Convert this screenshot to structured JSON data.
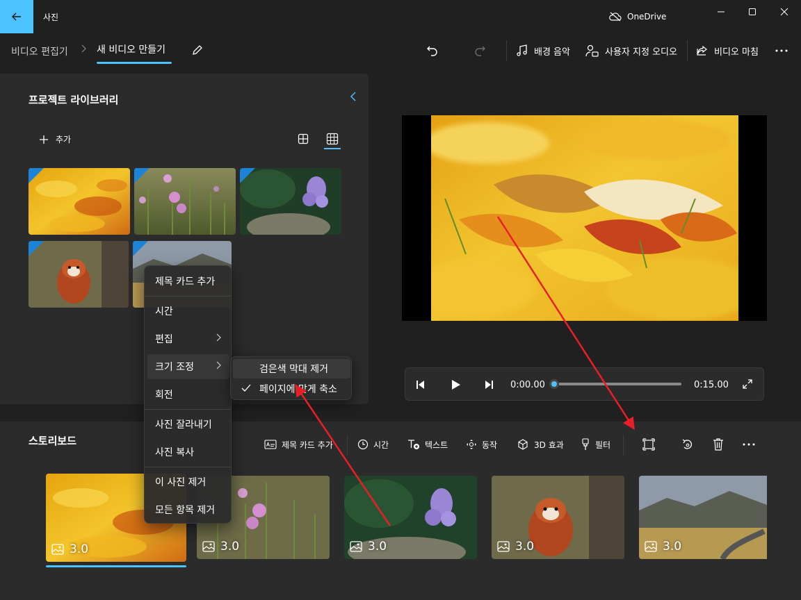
{
  "titlebar": {
    "app_title": "사진",
    "onedrive_label": "OneDrive",
    "accent": "#4cc2ff"
  },
  "nav": {
    "breadcrumb_root": "비디오 편집기",
    "breadcrumb_current": "새 비디오 만들기"
  },
  "toolbar": {
    "bg_music_label": "배경 음악",
    "custom_audio_label": "사용자 지정 오디오",
    "finish_video_label": "비디오 마침"
  },
  "library": {
    "title": "프로젝트 라이브러리",
    "add_label": "추가",
    "items": [
      {
        "subject": "autumn leaves"
      },
      {
        "subject": "purple wildflowers"
      },
      {
        "subject": "purple hyacinth flower"
      },
      {
        "subject": "red panda"
      },
      {
        "subject": "mountain road landscape"
      }
    ]
  },
  "context_menu": {
    "items": [
      "제목 카드 추가",
      "시간",
      "편집",
      "크기 조정",
      "회전",
      "사진 잘라내기",
      "사진 복사",
      "이 사진 제거",
      "모든 항목 제거"
    ]
  },
  "resize_submenu": {
    "items": [
      "검은색 막대 제거",
      "페이지에 맞게 축소"
    ],
    "checked_index": 1
  },
  "player": {
    "current_time": "0:00.00",
    "total_time": "0:15.00",
    "progress": 0
  },
  "storyboard": {
    "title": "스토리보드",
    "tools": [
      "제목 카드 추가",
      "시간",
      "텍스트",
      "동작",
      "3D 효과",
      "필터"
    ],
    "clips": [
      {
        "duration": "3.0",
        "subject": "autumn leaves",
        "selected": true
      },
      {
        "duration": "3.0",
        "subject": "purple wildflowers"
      },
      {
        "duration": "3.0",
        "subject": "purple hyacinth flower"
      },
      {
        "duration": "3.0",
        "subject": "red panda"
      },
      {
        "duration": "3.0",
        "subject": "mountain road landscape"
      }
    ]
  }
}
